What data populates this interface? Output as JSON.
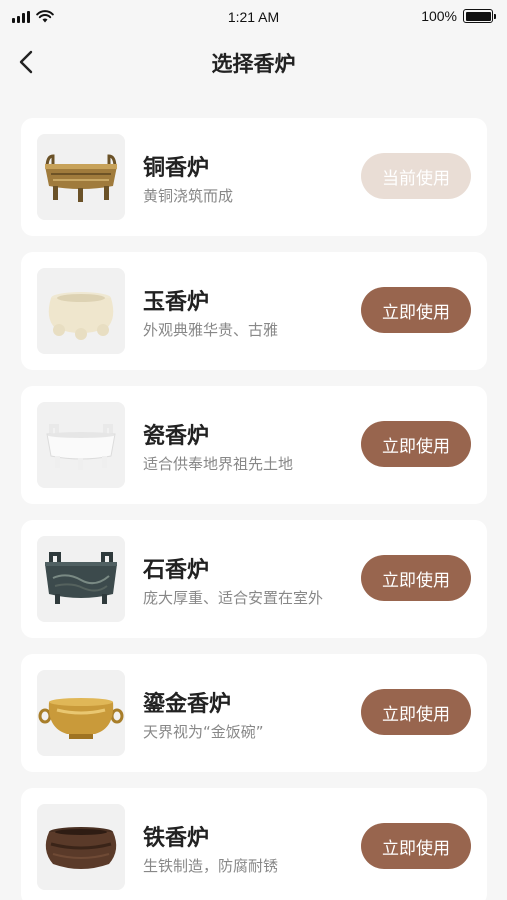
{
  "status_bar": {
    "time": "1:21 AM",
    "battery_text": "100%"
  },
  "nav": {
    "title": "选择香炉"
  },
  "colors": {
    "accent": "#98654e",
    "current_bg": "#e9ddd5",
    "background": "#f6f6f6"
  },
  "burners": [
    {
      "name": "铜香炉",
      "desc": "黄铜浇筑而成",
      "action": "当前使用",
      "state": "current",
      "icon": "bronze-censer-icon"
    },
    {
      "name": "玉香炉",
      "desc": "外观典雅华贵、古雅",
      "action": "立即使用",
      "state": "available",
      "icon": "jade-censer-icon"
    },
    {
      "name": "瓷香炉",
      "desc": "适合供奉地界祖先土地",
      "action": "立即使用",
      "state": "available",
      "icon": "porcelain-censer-icon"
    },
    {
      "name": "石香炉",
      "desc": "庞大厚重、适合安置在室外",
      "action": "立即使用",
      "state": "available",
      "icon": "stone-censer-icon"
    },
    {
      "name": "鎏金香炉",
      "desc": "天界视为“金饭碗”",
      "action": "立即使用",
      "state": "available",
      "icon": "gilded-censer-icon"
    },
    {
      "name": "铁香炉",
      "desc": "生铁制造，防腐耐锈",
      "action": "立即使用",
      "state": "available",
      "icon": "iron-censer-icon"
    }
  ]
}
